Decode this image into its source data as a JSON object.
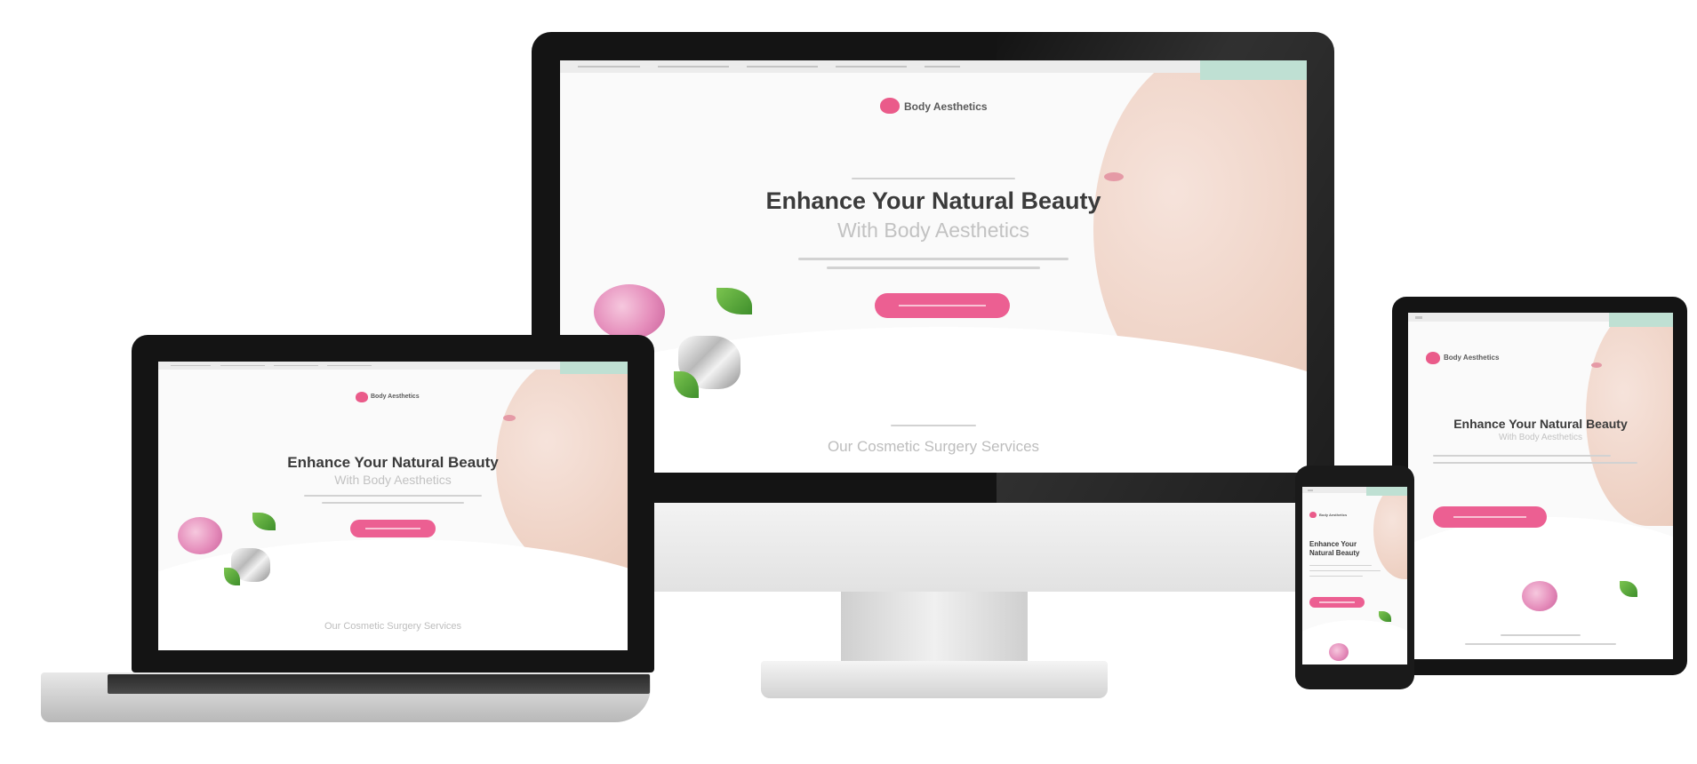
{
  "brand": {
    "name": "Body Aesthetics",
    "accent_color": "#ec5f92",
    "button_color": "#ec5f92",
    "topbar_button_color": "#bfe0d3"
  },
  "hero": {
    "title": "Enhance Your Natural Beauty",
    "title_phone_line1": "Enhance Your",
    "title_phone_line2": "Natural Beauty",
    "subtitle": "With Body Aesthetics"
  },
  "services": {
    "title": "Our Cosmetic Surgery Services"
  },
  "devices": [
    "monitor",
    "laptop",
    "tablet",
    "phone"
  ]
}
